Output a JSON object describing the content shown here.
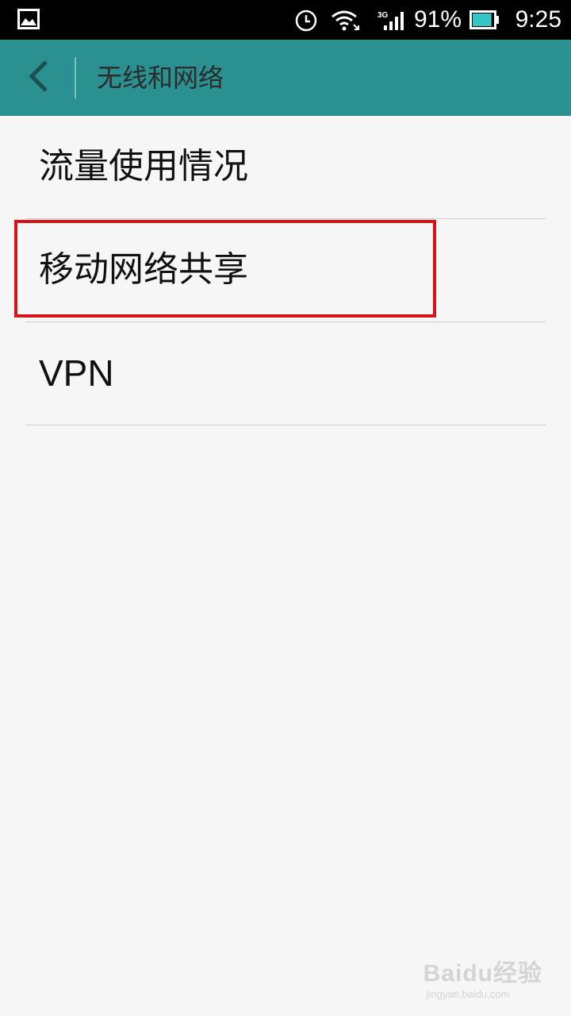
{
  "status_bar": {
    "battery_percent": "91%",
    "time": "9:25",
    "network_type": "3G",
    "battery_level": 0.91,
    "icons": [
      "gallery-icon",
      "alarm-icon",
      "wifi-icon",
      "signal-icon",
      "battery-icon"
    ]
  },
  "header": {
    "title": "无线和网络",
    "back_icon": "chevron-left-icon",
    "background_color": "#2a9090"
  },
  "list": {
    "items": [
      {
        "label": "流量使用情况"
      },
      {
        "label": "移动网络共享",
        "highlighted": true
      },
      {
        "label": "VPN"
      }
    ],
    "highlight_color": "#d9121a"
  },
  "watermark": {
    "main": "Baidu经验",
    "sub": "jingyan.baidu.com"
  }
}
